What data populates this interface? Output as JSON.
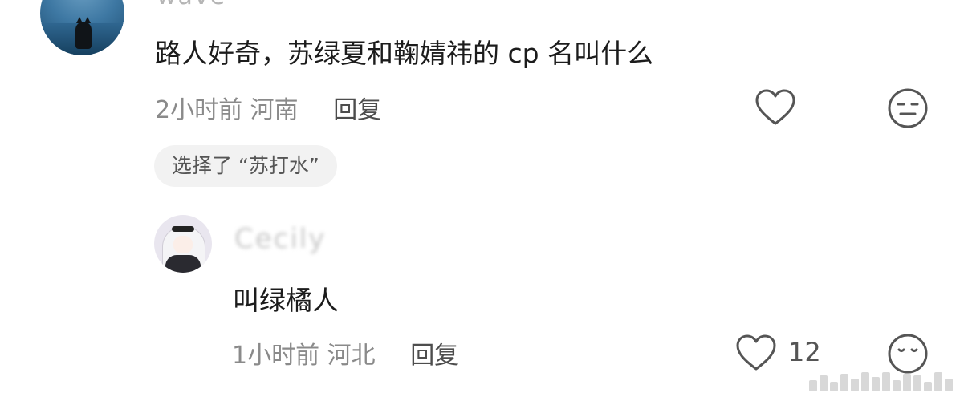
{
  "comment": {
    "username": "wave",
    "text": "路人好奇，苏绿夏和鞠婧祎的 cp 名叫什么",
    "time": "2小时前",
    "location": "河南",
    "reply_label": "回复",
    "selected_chip": "选择了 “苏打水”"
  },
  "reply": {
    "username": "Cecily",
    "text": "叫绿橘人",
    "time": "1小时前",
    "location": "河北",
    "reply_label": "回复",
    "like_count": "12"
  },
  "icons": {
    "like": "heart-icon",
    "reaction": "emoji-face-icon"
  }
}
